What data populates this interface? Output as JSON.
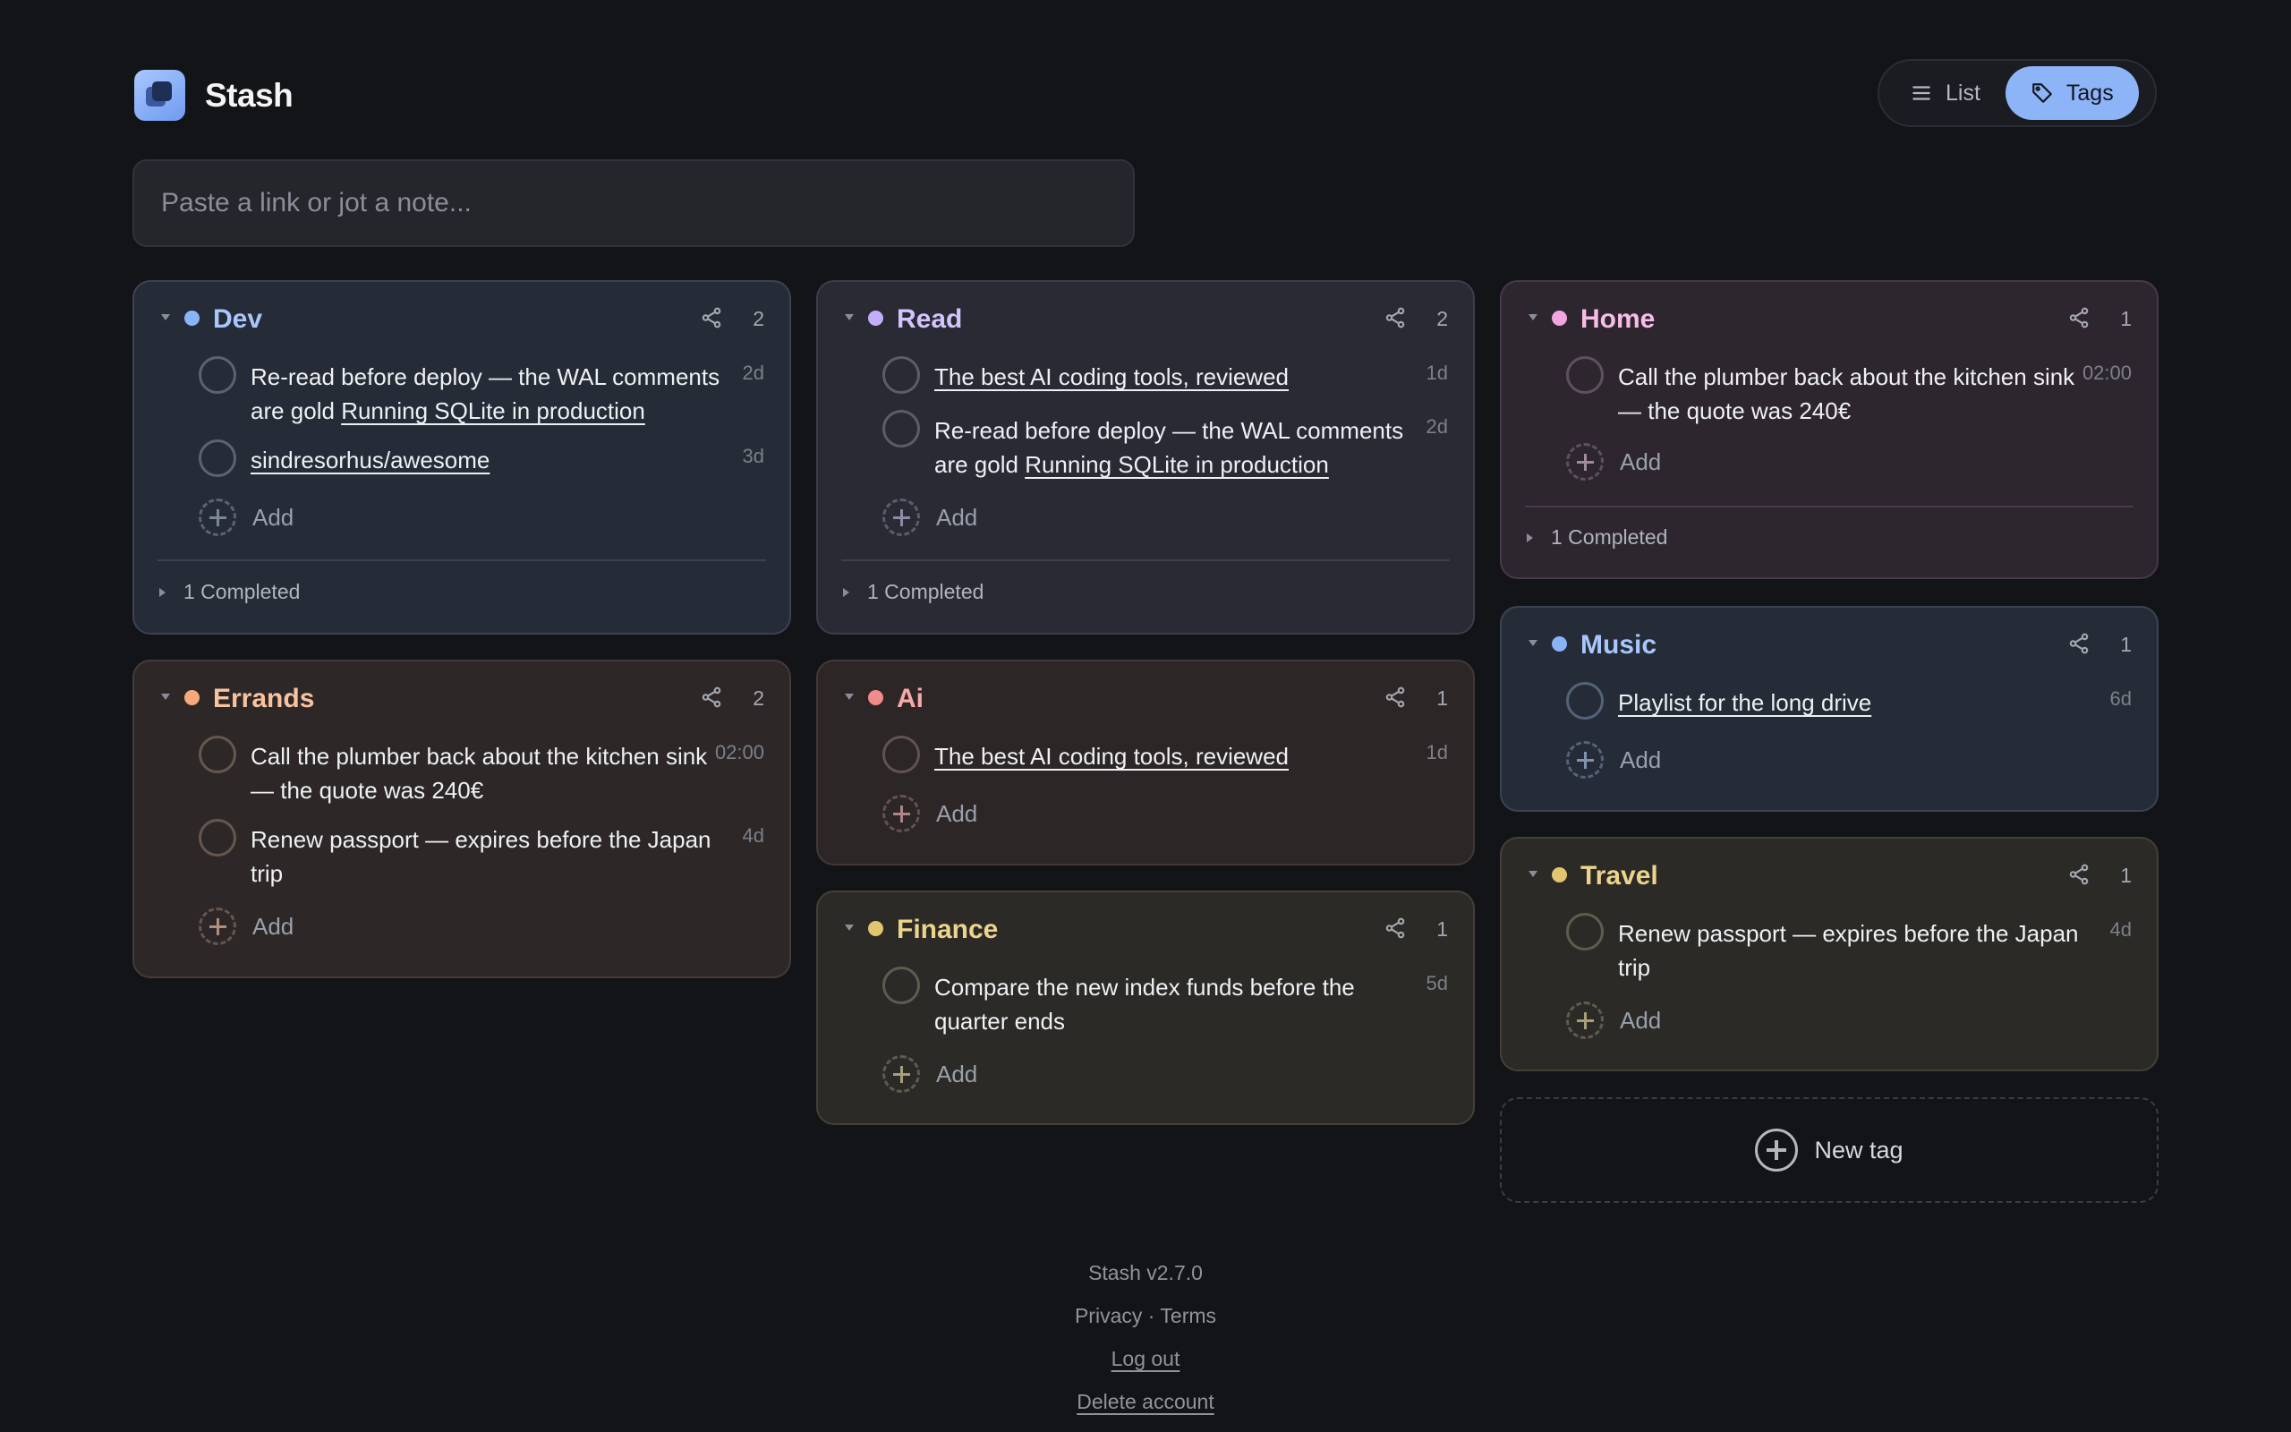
{
  "app": {
    "name": "Stash",
    "version": "Stash v2.7.0"
  },
  "view_toggle": {
    "list_label": "List",
    "tags_label": "Tags",
    "active": "Tags"
  },
  "quick_input": {
    "placeholder": "Paste a link or jot a note..."
  },
  "tags": {
    "dev": {
      "name": "Dev",
      "count": "2",
      "color": "#8ab4f8",
      "items": [
        {
          "text": "Re-read before deploy — the WAL comments are gold ",
          "link": "Running SQLite in production",
          "age": "2d"
        },
        {
          "text": "",
          "link": "sindresorhus/awesome",
          "age": "3d"
        }
      ],
      "add_label": "Add",
      "completed_label": "1 Completed"
    },
    "read": {
      "name": "Read",
      "count": "2",
      "color": "#c3aefc",
      "items": [
        {
          "text": "",
          "link": "The best AI coding tools, reviewed",
          "age": "1d"
        },
        {
          "text": "Re-read before deploy — the WAL comments are gold ",
          "link": "Running SQLite in production",
          "age": "2d"
        }
      ],
      "add_label": "Add",
      "completed_label": "1 Completed"
    },
    "home": {
      "name": "Home",
      "count": "1",
      "color": "#f1a6e0",
      "items": [
        {
          "text": "Call the plumber back about the kitchen sink — the quote was 240€",
          "link": "",
          "age": "02:00"
        }
      ],
      "add_label": "Add",
      "completed_label": "1 Completed"
    },
    "errands": {
      "name": "Errands",
      "count": "2",
      "color": "#f6a97a",
      "items": [
        {
          "text": "Call the plumber back about the kitchen sink — the quote was 240€",
          "link": "",
          "age": "02:00"
        },
        {
          "text": "Renew passport — expires before the Japan trip",
          "link": "",
          "age": "4d"
        }
      ],
      "add_label": "Add"
    },
    "ai": {
      "name": "Ai",
      "count": "1",
      "color": "#f28b8b",
      "items": [
        {
          "text": "",
          "link": "The best AI coding tools, reviewed",
          "age": "1d"
        }
      ],
      "add_label": "Add"
    },
    "music": {
      "name": "Music",
      "count": "1",
      "color": "#8ab4f8",
      "items": [
        {
          "text": "",
          "link": "Playlist for the long drive",
          "age": "6d"
        }
      ],
      "add_label": "Add"
    },
    "finance": {
      "name": "Finance",
      "count": "1",
      "color": "#e2c66f",
      "items": [
        {
          "text": "Compare the new index funds before the quarter ends",
          "link": "",
          "age": "5d"
        }
      ],
      "add_label": "Add"
    },
    "travel": {
      "name": "Travel",
      "count": "1",
      "color": "#e2c66f",
      "items": [
        {
          "text": "Renew passport — expires before the Japan trip",
          "link": "",
          "age": "4d"
        }
      ],
      "add_label": "Add"
    }
  },
  "new_tag_label": "New tag",
  "footer": {
    "version": "Stash v2.7.0",
    "privacy": "Privacy",
    "separator": "·",
    "terms": "Terms",
    "logout": "Log out",
    "delete": "Delete account"
  },
  "icons": {
    "logo": "stacked-squares-icon",
    "list": "list-icon",
    "tags": "tag-icon",
    "share": "share-icon",
    "add": "plus-circle-icon"
  }
}
